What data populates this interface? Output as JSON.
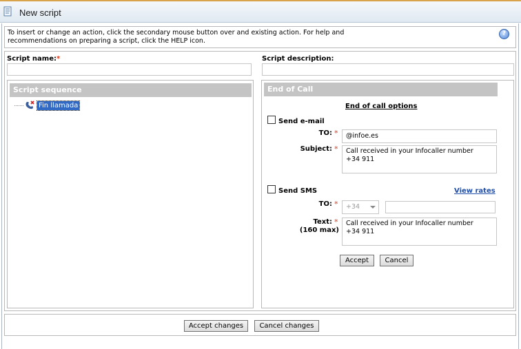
{
  "window": {
    "title": "New script",
    "icon": "script-icon"
  },
  "info": {
    "text_line1": "To insert or change an action, click the secondary mouse button over and existing action. For help and",
    "text_line2": "recommendations on preparing a script, click the HELP icon.",
    "help_icon": "help-icon",
    "help_glyph": "?"
  },
  "form": {
    "script_name_label": "Script name:",
    "required_mark": "*",
    "script_name_value": "",
    "script_description_label": "Script description:",
    "script_description_value": ""
  },
  "sequence": {
    "header": "Script sequence",
    "items": [
      {
        "label": "Fin llamada",
        "icon": "phone-hangup-icon",
        "selected": true
      }
    ]
  },
  "action_panel": {
    "header": "End of Call",
    "section_title": "End of call options",
    "email": {
      "checkbox_label": "Send e-mail",
      "checked": false,
      "to_label": "TO:",
      "to_value": "@infoe.es",
      "subject_label": "Subject:",
      "subject_line1": "Call received in your Infocaller number",
      "subject_line2": "+34 911"
    },
    "sms": {
      "checkbox_label": "Send SMS",
      "checked": false,
      "view_rates": "View rates",
      "to_label": "TO:",
      "prefix_value": "+34",
      "number_value": "",
      "text_label": "Text:",
      "text_sublabel": "(160 max)",
      "text_line1": "Call received in your Infocaller number",
      "text_line2": "+34 911"
    },
    "accept_label": "Accept",
    "cancel_label": "Cancel"
  },
  "footer": {
    "accept_changes_label": "Accept changes",
    "cancel_changes_label": "Cancel changes"
  },
  "colors": {
    "panel_header_bg": "#c4c4c4",
    "required_mark": "#e03b1b",
    "selection_bg": "#316ac5",
    "link": "#1f4fa8"
  }
}
